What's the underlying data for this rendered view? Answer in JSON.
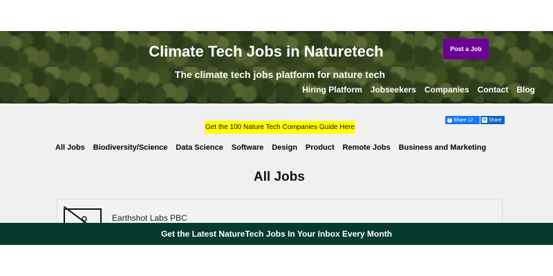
{
  "header": {
    "title": "Climate Tech Jobs in Naturetech",
    "subtitle": "The climate tech jobs platform for nature tech",
    "post_job_label": "Post a Job",
    "nav": [
      "Hiring Platform",
      "Jobseekers",
      "Companies",
      "Contact",
      "Blog"
    ]
  },
  "share": {
    "facebook_label": "Share 12",
    "linkedin_label": "Share"
  },
  "guide_link": "Get the 100 Nature Tech Companies Guide Here",
  "categories": [
    "All Jobs",
    "Biodiversity/Science",
    "Data Science",
    "Software",
    "Design",
    "Product",
    "Remote Jobs",
    "Business and Marketing"
  ],
  "section_title": "All Jobs",
  "jobs": [
    {
      "company": "Earthshot Labs PBC"
    }
  ],
  "newsletter_banner": "Get the Latest NatureTech Jobs In Your Inbox Every Month",
  "colors": {
    "post_job_bg": "#6c0096",
    "guide_highlight": "#ffff0a",
    "banner_bg": "#063a2f",
    "facebook": "#1877f2",
    "linkedin": "#0a66c2"
  }
}
